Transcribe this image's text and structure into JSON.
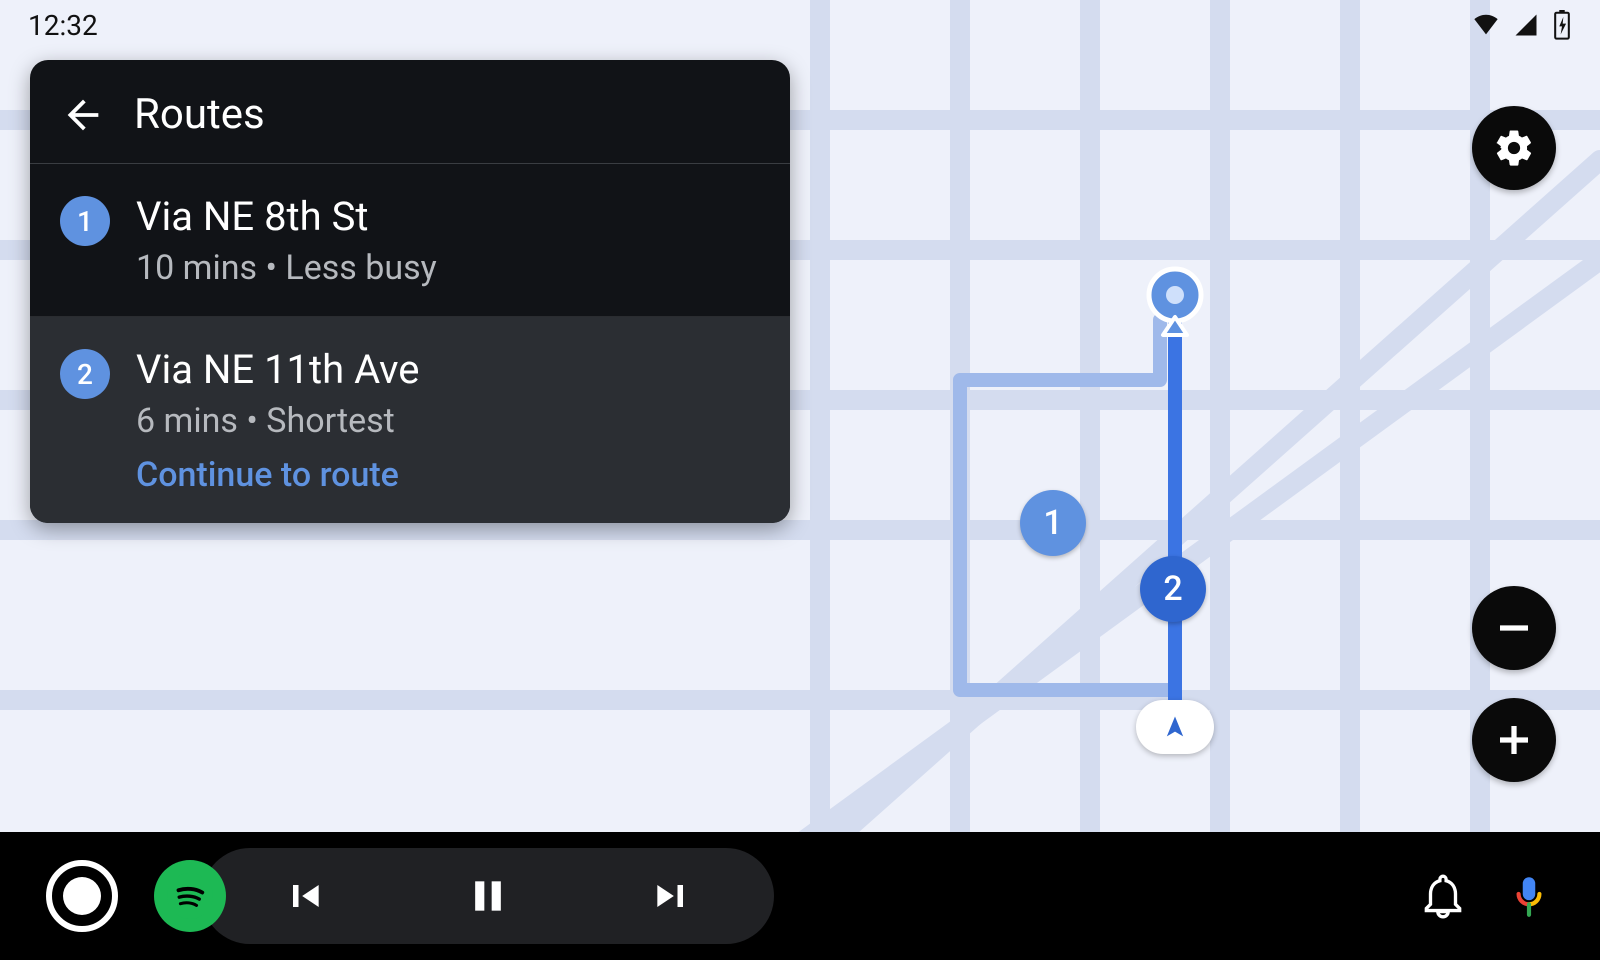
{
  "status": {
    "time": "12:32"
  },
  "panel": {
    "title": "Routes",
    "routes": [
      {
        "num": "1",
        "name": "Via NE 8th St",
        "sub": "10 mins • Less busy",
        "selected": false
      },
      {
        "num": "2",
        "name": "Via NE 11th Ave",
        "sub": "6 mins • Shortest",
        "selected": true,
        "continue_label": "Continue to route"
      }
    ]
  },
  "map": {
    "badges": {
      "one": "1",
      "two": "2"
    }
  },
  "colors": {
    "badge_light": "#5f92e0",
    "badge_dark": "#2f66cf",
    "route_active": "#3b74e3",
    "route_alt": "#9fb9ea",
    "spotify": "#1db954",
    "assistant_top": "#4285F4",
    "assistant_bottom_red": "#EA4335",
    "assistant_bottom_yellow": "#FBBC05",
    "assistant_bottom_green": "#34A853"
  }
}
